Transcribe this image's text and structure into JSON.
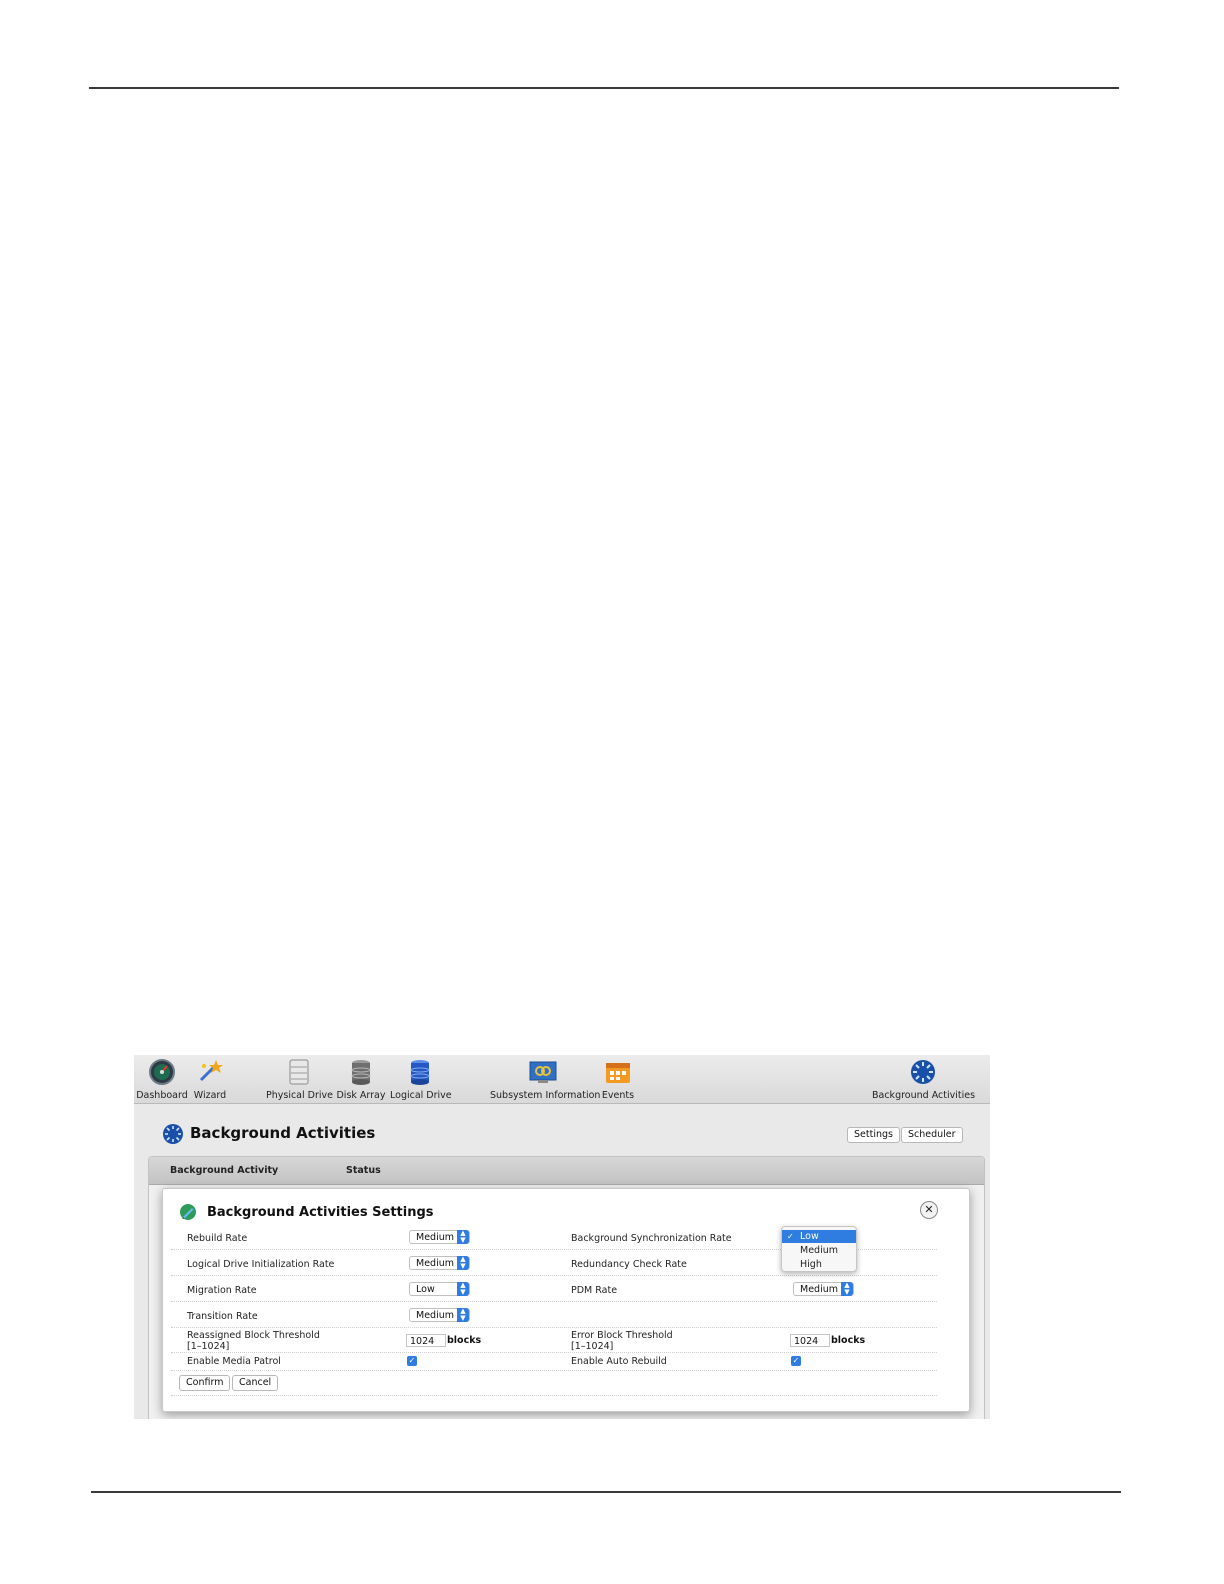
{
  "toolbar": {
    "items": [
      {
        "label": "Dashboard",
        "icon": "dashboard-gauge-icon"
      },
      {
        "label": "Wizard",
        "icon": "wizard-icon"
      },
      {
        "label": "Physical Drive",
        "icon": "physical-drive-icon"
      },
      {
        "label": "Disk Array",
        "icon": "disk-array-icon"
      },
      {
        "label": "Logical Drive",
        "icon": "logical-drive-icon"
      },
      {
        "label": "Subsystem Information",
        "icon": "subsystem-information-icon"
      },
      {
        "label": "Events",
        "icon": "events-calendar-icon"
      },
      {
        "label": "Background Activities",
        "icon": "background-activities-icon"
      }
    ]
  },
  "page": {
    "title": "Background Activities",
    "settings_label": "Settings",
    "scheduler_label": "Scheduler"
  },
  "table": {
    "columns": [
      "Background Activity",
      "Status"
    ]
  },
  "dialog": {
    "title": "Background Activities Settings",
    "rebuild_rate": {
      "label": "Rebuild Rate",
      "value": "Medium"
    },
    "init_rate": {
      "label": "Logical Drive Initialization Rate",
      "value": "Medium"
    },
    "migration_rate": {
      "label": "Migration Rate",
      "value": "Low"
    },
    "transition_rate": {
      "label": "Transition Rate",
      "value": "Medium"
    },
    "reassigned": {
      "label": "Reassigned Block Threshold",
      "range": "[1–1024]",
      "value": "1024",
      "unit": "blocks"
    },
    "media_patrol": {
      "label": "Enable Media Patrol",
      "checked": true
    },
    "bg_sync_rate": {
      "label": "Background Synchronization Rate"
    },
    "redundancy_rate": {
      "label": "Redundancy Check Rate"
    },
    "pdm_rate": {
      "label": "PDM Rate",
      "value": "Medium"
    },
    "error_block": {
      "label": "Error Block Threshold",
      "range": "[1–1024]",
      "value": "1024",
      "unit": "blocks"
    },
    "auto_rebuild": {
      "label": "Enable Auto Rebuild",
      "checked": true
    },
    "dropdown": {
      "options": [
        "Low",
        "Medium",
        "High"
      ],
      "selected": "Low"
    },
    "confirm_label": "Confirm",
    "cancel_label": "Cancel"
  },
  "colors": {
    "accent": "#2f7de1",
    "toolbar_bg": "#dcdcdc",
    "panel_bg": "#e9e9e9"
  }
}
